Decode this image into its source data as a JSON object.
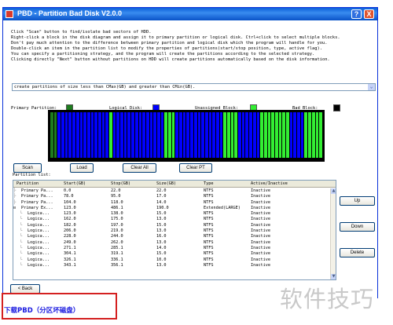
{
  "window": {
    "title": "PBD - Partition Bad Disk V2.0.0",
    "help_label": "?",
    "close_label": "X"
  },
  "instructions": [
    "Click \"Scan\" button to find/isolate bad sectors of HDD.",
    "Right-click a block in the disk diagram and assign it to primary partition or logical disk. Ctrl+click to select multiple blocks.",
    "Don't pay much attention to the difference between primary partition and logical disk which the program will handle for you.",
    "Double-click an item in the partition list to modify the properties of partitions(start/stop position, type, active flag).",
    "You can specify a partitioning strategy, and the program will create the partitions according to the selected strategy.",
    "Clicking directly \"Next\" button without partitions on HDD will create partitions automatically based on the disk information."
  ],
  "strategy": {
    "selected": "create partitions of size less than CMax(GB) and greater than CMin(GB).",
    "arrow": "⌄"
  },
  "legend": {
    "primary": {
      "label": "Primary Partition:",
      "color": "#1e7d1e"
    },
    "logical": {
      "label": "Logical Disk:",
      "color": "#0000ff"
    },
    "unassigned": {
      "label": "Unassigned Block:",
      "color": "#33ee33"
    },
    "bad": {
      "label": "Bad Block:",
      "color": "#000000"
    }
  },
  "disk_blocks": [
    "primary",
    "primary",
    "logical",
    "logical",
    "logical",
    "logical",
    "logical",
    "logical",
    "logical",
    "logical",
    "logical",
    "logical",
    "logical",
    "logical",
    "logical",
    "logical",
    "unassigned",
    "logical",
    "logical",
    "logical",
    "logical",
    "logical",
    "logical",
    "logical",
    "logical",
    "logical",
    "logical",
    "logical",
    "logical",
    "logical",
    "logical",
    "unassigned",
    "unassigned",
    "unassigned",
    "logical",
    "logical",
    "logical",
    "logical",
    "logical",
    "logical",
    "logical",
    "logical",
    "logical",
    "logical",
    "logical",
    "logical",
    "logical",
    "unassigned",
    "unassigned",
    "unassigned",
    "unassigned",
    "logical",
    "logical",
    "logical",
    "logical",
    "logical",
    "logical",
    "unassigned",
    "unassigned",
    "unassigned",
    "unassigned",
    "unassigned",
    "unassigned",
    "unassigned",
    "unassigned",
    "logical",
    "logical",
    "logical",
    "logical",
    "unassigned",
    "unassigned",
    "unassigned",
    "unassigned",
    "unassigned"
  ],
  "buttons": {
    "scan": "Scan",
    "load": "Load",
    "clear_all": "Clear All",
    "clear_pt": "Clear PT",
    "up": "Up",
    "down": "Down",
    "delete": "Delete",
    "back": "< Back"
  },
  "partition_list": {
    "label": "Partition list:",
    "columns": [
      "Partition",
      "Start(GB)",
      "Stop(GB)",
      "Size(GB)",
      "Type",
      "Active/Inactive"
    ],
    "rows": [
      {
        "partition": "Primary Pa...",
        "start": "0.0",
        "stop": "22.0",
        "size": "22.0",
        "type": "NTFS",
        "active": "Inactive",
        "level": 0
      },
      {
        "partition": "Primary Pa...",
        "start": "78.0",
        "stop": "95.0",
        "size": "17.0",
        "type": "NTFS",
        "active": "Inactive",
        "level": 0
      },
      {
        "partition": "Primary Pa...",
        "start": "104.0",
        "stop": "118.0",
        "size": "14.0",
        "type": "NTFS",
        "active": "Inactive",
        "level": 0
      },
      {
        "partition": "Primary Ex...",
        "start": "123.0",
        "stop": "486.1",
        "size": "190.0",
        "type": "Extended(LARGE)",
        "active": "Inactive",
        "level": 0,
        "expander": "−"
      },
      {
        "partition": "Logica...",
        "start": "123.0",
        "stop": "138.0",
        "size": "15.0",
        "type": "NTFS",
        "active": "Inactive",
        "level": 1
      },
      {
        "partition": "Logica...",
        "start": "162.0",
        "stop": "175.0",
        "size": "13.0",
        "type": "NTFS",
        "active": "Inactive",
        "level": 1
      },
      {
        "partition": "Logica...",
        "start": "182.0",
        "stop": "197.0",
        "size": "15.0",
        "type": "NTFS",
        "active": "Inactive",
        "level": 1
      },
      {
        "partition": "Logica...",
        "start": "206.0",
        "stop": "219.0",
        "size": "13.0",
        "type": "NTFS",
        "active": "Inactive",
        "level": 1
      },
      {
        "partition": "Logica...",
        "start": "228.0",
        "stop": "244.0",
        "size": "16.0",
        "type": "NTFS",
        "active": "Inactive",
        "level": 1
      },
      {
        "partition": "Logica...",
        "start": "249.0",
        "stop": "262.0",
        "size": "13.0",
        "type": "NTFS",
        "active": "Inactive",
        "level": 1
      },
      {
        "partition": "Logica...",
        "start": "271.1",
        "stop": "285.1",
        "size": "14.0",
        "type": "NTFS",
        "active": "Inactive",
        "level": 1
      },
      {
        "partition": "Logica...",
        "start": "304.1",
        "stop": "319.1",
        "size": "15.0",
        "type": "NTFS",
        "active": "Inactive",
        "level": 1
      },
      {
        "partition": "Logica...",
        "start": "326.1",
        "stop": "336.1",
        "size": "10.0",
        "type": "NTFS",
        "active": "Inactive",
        "level": 1
      },
      {
        "partition": "Logica...",
        "start": "343.1",
        "stop": "356.1",
        "size": "13.0",
        "type": "NTFS",
        "active": "Inactive",
        "level": 1
      }
    ]
  },
  "scrollbar": {
    "up": "▲",
    "down": "▼"
  },
  "watermark": "软件技巧",
  "download_link": "下载PBD（分区坏磁盘）"
}
